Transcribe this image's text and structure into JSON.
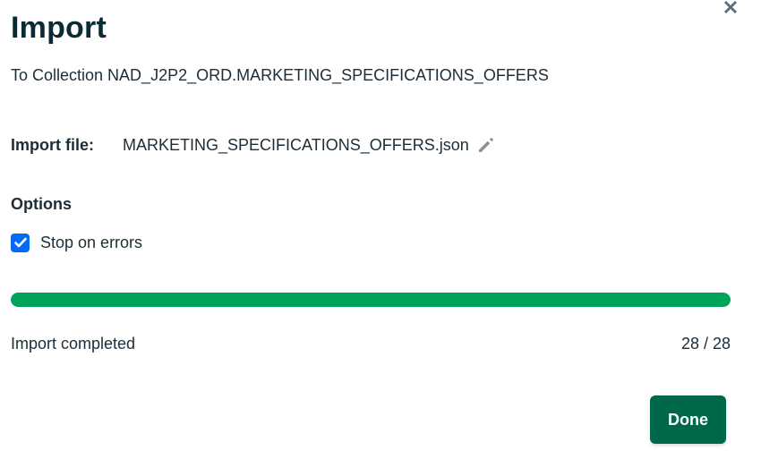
{
  "dialog": {
    "title": "Import",
    "subtitle": "To Collection NAD_J2P2_ORD.MARKETING_SPECIFICATIONS_OFFERS",
    "close_icon": "close-icon"
  },
  "import_file": {
    "label": "Import file:",
    "filename": "MARKETING_SPECIFICATIONS_OFFERS.json",
    "edit_icon": "pencil-icon"
  },
  "options": {
    "heading": "Options",
    "stop_on_errors": {
      "label": "Stop on errors",
      "checked": true
    }
  },
  "progress": {
    "fraction": 1.0,
    "status": "Import completed",
    "count": "28 / 28"
  },
  "footer": {
    "done_label": "Done"
  },
  "colors": {
    "accent_blue": "#016bf8",
    "progress_green": "#00a35c",
    "button_green": "#00684a",
    "text": "#1c2d38"
  }
}
